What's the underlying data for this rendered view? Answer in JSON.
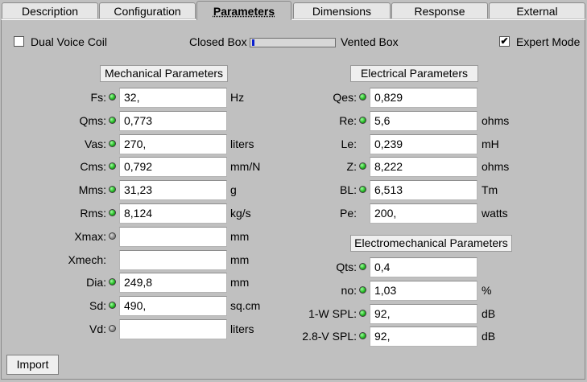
{
  "tabs": [
    {
      "label": "Description"
    },
    {
      "label": "Configuration"
    },
    {
      "label": "Parameters"
    },
    {
      "label": "Dimensions"
    },
    {
      "label": "Response"
    },
    {
      "label": "External"
    }
  ],
  "options": {
    "dual_voice_coil": {
      "label": "Dual Voice Coil",
      "checked": false
    },
    "box_type": {
      "left_label": "Closed Box",
      "right_label": "Vented Box",
      "level": 0.0
    },
    "expert_mode": {
      "label": "Expert Mode",
      "checked": true,
      "mark": "✔"
    }
  },
  "mechanical": {
    "title": "Mechanical Parameters",
    "rows": [
      {
        "label": "Fs:",
        "value": "32,",
        "unit": "Hz",
        "led": "on"
      },
      {
        "label": "Qms:",
        "value": "0,773",
        "unit": "",
        "led": "on"
      },
      {
        "label": "Vas:",
        "value": "270,",
        "unit": "liters",
        "led": "on"
      },
      {
        "label": "Cms:",
        "value": "0,792",
        "unit": "mm/N",
        "led": "on"
      },
      {
        "label": "Mms:",
        "value": "31,23",
        "unit": "g",
        "led": "on"
      },
      {
        "label": "Rms:",
        "value": "8,124",
        "unit": "kg/s",
        "led": "on"
      },
      {
        "label": "Xmax:",
        "value": "",
        "unit": "mm",
        "led": "off"
      },
      {
        "label": "Xmech:",
        "value": "",
        "unit": "mm",
        "led": "none"
      },
      {
        "label": "Dia:",
        "value": "249,8",
        "unit": "mm",
        "led": "on"
      },
      {
        "label": "Sd:",
        "value": "490,",
        "unit": "sq.cm",
        "led": "on"
      },
      {
        "label": "Vd:",
        "value": "",
        "unit": "liters",
        "led": "off"
      }
    ]
  },
  "electrical": {
    "title": "Electrical Parameters",
    "rows": [
      {
        "label": "Qes:",
        "value": "0,829",
        "unit": "",
        "led": "on"
      },
      {
        "label": "Re:",
        "value": "5,6",
        "unit": "ohms",
        "led": "on"
      },
      {
        "label": "Le:",
        "value": "0,239",
        "unit": "mH",
        "led": "none"
      },
      {
        "label": "Z:",
        "value": "8,222",
        "unit": "ohms",
        "led": "on"
      },
      {
        "label": "BL:",
        "value": "6,513",
        "unit": "Tm",
        "led": "on"
      },
      {
        "label": "Pe:",
        "value": "200,",
        "unit": "watts",
        "led": "none"
      }
    ]
  },
  "electromechanical": {
    "title": "Electromechanical Parameters",
    "rows": [
      {
        "label": "Qts:",
        "value": "0,4",
        "unit": "",
        "led": "on"
      },
      {
        "label": "no:",
        "value": "1,03",
        "unit": "%",
        "led": "on"
      },
      {
        "label": "1-W SPL:",
        "value": "92,",
        "unit": "dB",
        "led": "on"
      },
      {
        "label": "2.8-V SPL:",
        "value": "92,",
        "unit": "dB",
        "led": "on"
      }
    ]
  },
  "footer": {
    "import_label": "Import"
  },
  "colors": {
    "led_on": "#1fb41f",
    "led_off": "#8c8c8c",
    "slider_thumb": "#0a1fcf",
    "background": "#c0c0c0"
  }
}
